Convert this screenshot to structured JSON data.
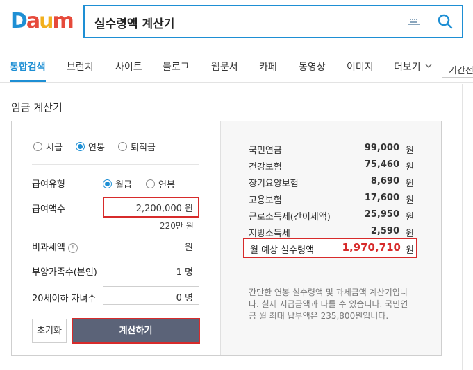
{
  "header": {
    "logo": "Daum",
    "search_value": "실수령액 계산기"
  },
  "tabs": [
    {
      "label": "통합검색",
      "active": true
    },
    {
      "label": "브런치"
    },
    {
      "label": "사이트"
    },
    {
      "label": "블로그"
    },
    {
      "label": "웹문서"
    },
    {
      "label": "카페"
    },
    {
      "label": "동영상"
    },
    {
      "label": "이미지"
    },
    {
      "label": "더보기"
    }
  ],
  "period_label": "기간전",
  "section_title": "임금 계산기",
  "calc_type": {
    "options": [
      "시급",
      "연봉",
      "퇴직금"
    ],
    "selected": "연봉"
  },
  "pay_type": {
    "label": "급여유형",
    "options": [
      "월급",
      "연봉"
    ],
    "selected": "월급"
  },
  "salary": {
    "label": "급여액수",
    "value": "2,200,000 원",
    "note": "220만 원"
  },
  "nontax": {
    "label": "비과세액",
    "info": "!",
    "value": "원"
  },
  "dependents": {
    "label": "부양가족수(본인)",
    "value": "1 명"
  },
  "children": {
    "label": "20세이하 자녀수",
    "value": "0 명"
  },
  "buttons": {
    "reset": "초기화",
    "calculate": "계산하기"
  },
  "results": {
    "unit": "원",
    "items": [
      {
        "label": "국민연금",
        "value": "99,000"
      },
      {
        "label": "건강보험",
        "value": "75,460"
      },
      {
        "label": "장기요양보험",
        "value": "8,690"
      },
      {
        "label": "고용보험",
        "value": "17,600"
      },
      {
        "label": "근로소득세(간이세액)",
        "value": "25,950"
      },
      {
        "label": "지방소득세",
        "value": "2,590"
      }
    ],
    "total_label": "월 예상 실수령액",
    "total_value": "1,970,710"
  },
  "description": "간단한 연봉 실수령액 및 과세금액 계산기입니다. 실제 지급금액과 다를 수 있습니다. 국민연금 월 최대 납부액은 235,800원입니다.",
  "colors": {
    "accent": "#1e8fd4",
    "highlight": "#d72b2b",
    "button": "#5b6378"
  }
}
